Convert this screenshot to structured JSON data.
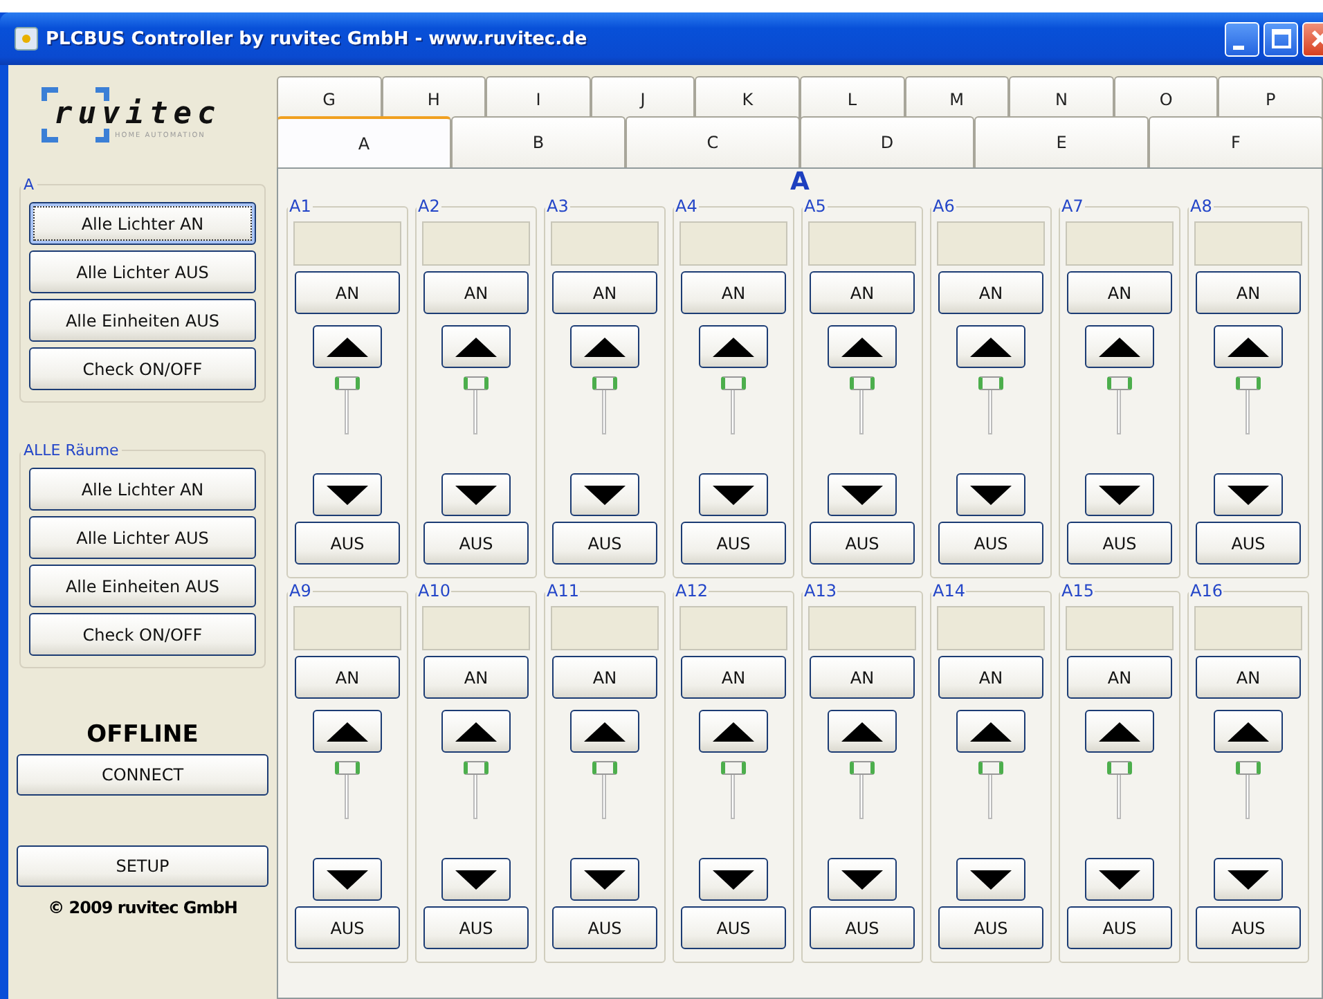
{
  "window": {
    "title": "PLCBUS Controller by ruvitec GmbH - www.ruvitec.de"
  },
  "sidebar": {
    "logo": {
      "name": "ruvitec",
      "tagline": "HOME AUTOMATION"
    },
    "groups": [
      {
        "title": "A",
        "buttons": [
          {
            "label": "Alle Lichter AN",
            "focused": true
          },
          {
            "label": "Alle Lichter AUS",
            "focused": false
          },
          {
            "label": "Alle Einheiten AUS",
            "focused": false
          },
          {
            "label": "Check ON/OFF",
            "focused": false
          }
        ]
      },
      {
        "title": "ALLE Räume",
        "buttons": [
          {
            "label": "Alle Lichter AN",
            "focused": false
          },
          {
            "label": "Alle Lichter AUS",
            "focused": false
          },
          {
            "label": "Alle Einheiten AUS",
            "focused": false
          },
          {
            "label": "Check ON/OFF",
            "focused": false
          }
        ]
      }
    ],
    "status": "OFFLINE",
    "connect_button": "CONNECT",
    "setup_button": "SETUP",
    "copyright": "© 2009 ruvitec GmbH"
  },
  "tabs_back_row": [
    {
      "label": "G",
      "selected": false
    },
    {
      "label": "H",
      "selected": false
    },
    {
      "label": "I",
      "selected": false
    },
    {
      "label": "J",
      "selected": false
    },
    {
      "label": "K",
      "selected": false
    },
    {
      "label": "L",
      "selected": false
    },
    {
      "label": "M",
      "selected": false
    },
    {
      "label": "N",
      "selected": false
    },
    {
      "label": "O",
      "selected": false
    },
    {
      "label": "P",
      "selected": false
    }
  ],
  "tabs_front_row": [
    {
      "label": "A",
      "selected": true
    },
    {
      "label": "B",
      "selected": false
    },
    {
      "label": "C",
      "selected": false
    },
    {
      "label": "D",
      "selected": false
    },
    {
      "label": "E",
      "selected": false
    },
    {
      "label": "F",
      "selected": false
    }
  ],
  "panel": {
    "title": "A",
    "channels": [
      {
        "name": "A1",
        "on_label": "AN",
        "off_label": "AUS",
        "level": 1
      },
      {
        "name": "A2",
        "on_label": "AN",
        "off_label": "AUS",
        "level": 1
      },
      {
        "name": "A3",
        "on_label": "AN",
        "off_label": "AUS",
        "level": 1
      },
      {
        "name": "A4",
        "on_label": "AN",
        "off_label": "AUS",
        "level": 1
      },
      {
        "name": "A5",
        "on_label": "AN",
        "off_label": "AUS",
        "level": 1
      },
      {
        "name": "A6",
        "on_label": "AN",
        "off_label": "AUS",
        "level": 1
      },
      {
        "name": "A7",
        "on_label": "AN",
        "off_label": "AUS",
        "level": 1
      },
      {
        "name": "A8",
        "on_label": "AN",
        "off_label": "AUS",
        "level": 1
      },
      {
        "name": "A9",
        "on_label": "AN",
        "off_label": "AUS",
        "level": 1
      },
      {
        "name": "A10",
        "on_label": "AN",
        "off_label": "AUS",
        "level": 1
      },
      {
        "name": "A11",
        "on_label": "AN",
        "off_label": "AUS",
        "level": 1
      },
      {
        "name": "A12",
        "on_label": "AN",
        "off_label": "AUS",
        "level": 1
      },
      {
        "name": "A13",
        "on_label": "AN",
        "off_label": "AUS",
        "level": 1
      },
      {
        "name": "A14",
        "on_label": "AN",
        "off_label": "AUS",
        "level": 1
      },
      {
        "name": "A15",
        "on_label": "AN",
        "off_label": "AUS",
        "level": 1
      },
      {
        "name": "A16",
        "on_label": "AN",
        "off_label": "AUS",
        "level": 1
      }
    ]
  }
}
